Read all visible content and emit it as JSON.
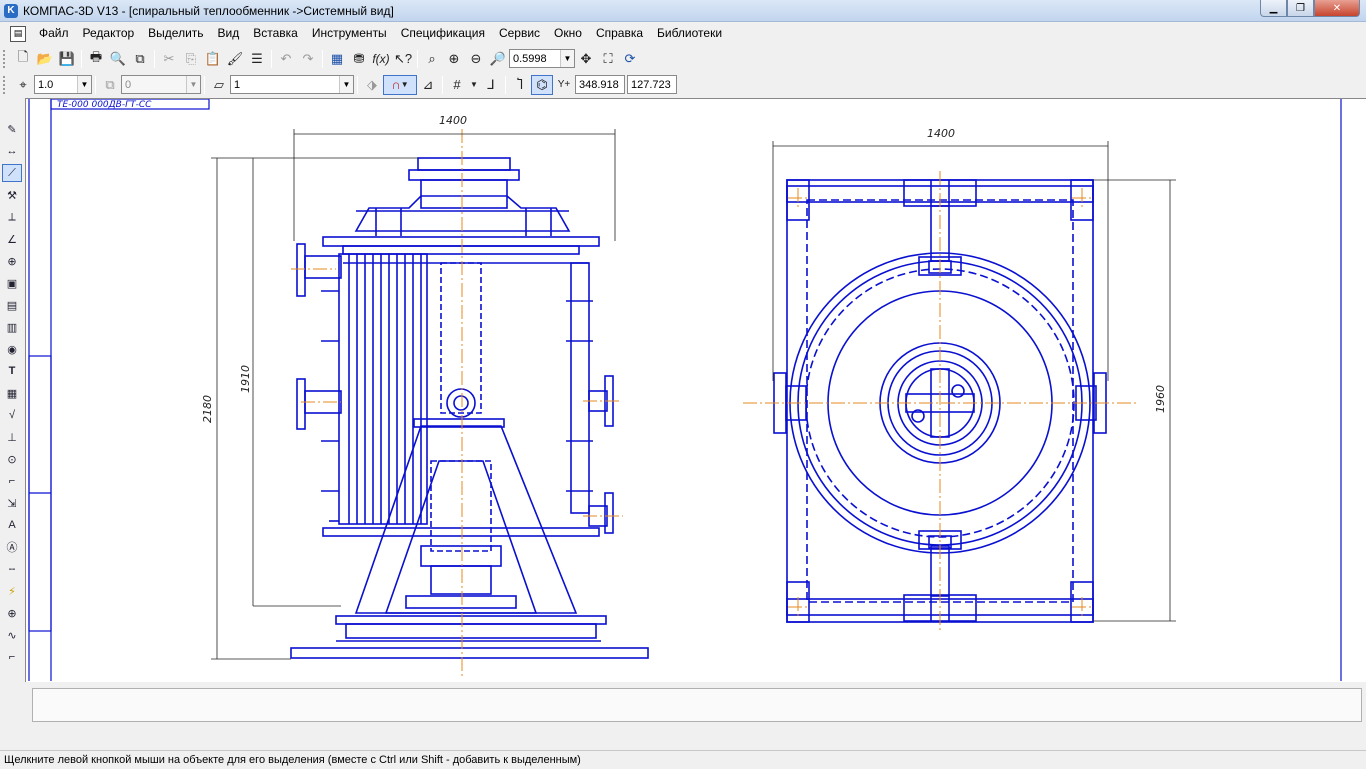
{
  "window": {
    "title": "КОМПАС-3D V13 - [спиральный теплообменник ->Системный вид]",
    "app_icon": "kompas-logo-icon",
    "buttons": {
      "minimize": "▁",
      "maximize": "❐",
      "close": "✕"
    }
  },
  "menu": {
    "items": [
      "Файл",
      "Редактор",
      "Выделить",
      "Вид",
      "Вставка",
      "Инструменты",
      "Спецификация",
      "Сервис",
      "Окно",
      "Справка",
      "Библиотеки"
    ],
    "mdi_buttons": [
      "‗",
      "❐",
      "✕"
    ]
  },
  "toolbar1": {
    "zoom_value": "0.5998",
    "icons": [
      "new-document-icon",
      "open-icon",
      "save-icon",
      "print-icon",
      "preview-icon",
      "manager-icon",
      "cut-icon",
      "copy-icon",
      "paste-icon",
      "format-brush-icon",
      "properties-icon",
      "undo-icon",
      "redo-icon",
      "tree-icon",
      "variables-icon",
      "fx-icon",
      "help-pointer-icon",
      "zoom-frame-icon",
      "zoom-in-icon",
      "zoom-out-icon",
      "zoom-scale-icon",
      "pan-icon",
      "show-all-icon",
      "refresh-icon"
    ]
  },
  "toolbar2": {
    "step_value": "1.0",
    "layer_value": "0",
    "style_value": "1",
    "coord_x": "348.918",
    "coord_y": "127.723",
    "icons": [
      "cursor-step-icon",
      "layer-icon",
      "line-style-icon",
      "snap-magnet-icon",
      "ortho-icon",
      "grid-icon",
      "local-cs-icon",
      "step-cursor-icon",
      "round-icon",
      "xy-coords-icon"
    ]
  },
  "left_toolbar": {
    "icons": [
      "geometry-icon",
      "dimensions-icon",
      "designations-icon",
      "editing-icon",
      "parametrization-icon",
      "measure-icon",
      "selection-icon",
      "associative-views-icon",
      "spec-icon",
      "reports-icon",
      "insert-icon",
      "text-icon",
      "table-icon",
      "roughness-icon",
      "datum-icon",
      "leader-icon",
      "position-icon",
      "arrow-view-icon",
      "section-icon",
      "text-style-icon",
      "hatch-icon",
      "axis-icon",
      "break-icon",
      "center-mark-icon",
      "wave-line-icon",
      "corner-icon"
    ]
  },
  "drawing": {
    "dims": {
      "front_width": "1400",
      "front_height_total": "2180",
      "front_height_inner": "1910",
      "top_width": "1400",
      "top_height": "1960"
    },
    "title_fragment": "ТЕ-000 000ДВ-ГТ-СС",
    "colors": {
      "line": "#0a10d0",
      "axis": "#e58a1f",
      "dim": "#222222"
    }
  },
  "status": {
    "text": "Щелкните левой кнопкой мыши на объекте для его выделения (вместе с Ctrl или Shift - добавить к выделенным)"
  }
}
